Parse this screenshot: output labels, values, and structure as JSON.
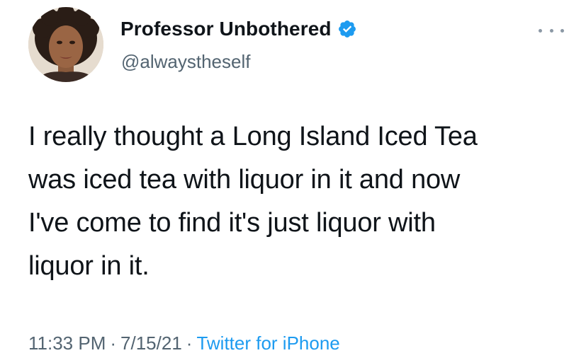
{
  "author": {
    "display_name": "Professor Unbothered",
    "handle": "@alwaystheself",
    "verified": true,
    "avatar_icon": "profile-photo"
  },
  "tweet": {
    "text": "I really thought a Long Island Iced Tea\nwas iced tea with liquor in it and now\nI've come to find it's just liquor with\nliquor in it.",
    "time": "11:33 PM",
    "date": "7/15/21",
    "separator": "·",
    "source": "Twitter for iPhone"
  },
  "colors": {
    "text_primary": "#0f1419",
    "text_secondary": "#536471",
    "link": "#1d9bf0",
    "verified_badge": "#1d9bf0"
  },
  "icons": {
    "more": "more-horizontal-icon",
    "verified": "verified-badge-icon"
  }
}
